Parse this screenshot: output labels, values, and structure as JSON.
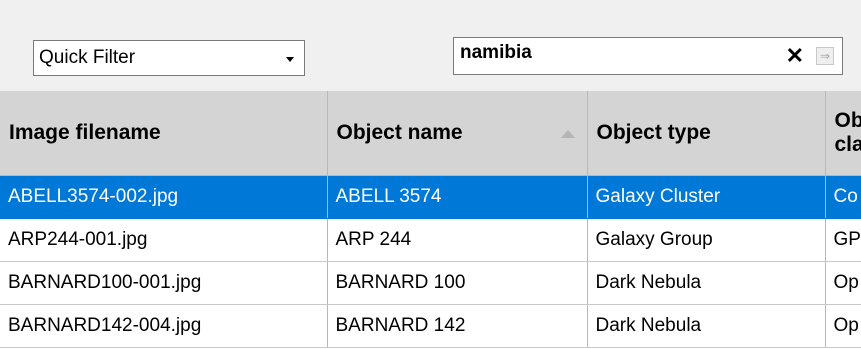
{
  "toolbar": {
    "quick_filter": {
      "selected": "Quick Filter"
    },
    "search": {
      "value": "namibia",
      "clear_glyph": "✕",
      "go_glyph": "⇒"
    }
  },
  "table": {
    "columns": [
      "Image filename",
      "Object name",
      "Object type",
      "Object class"
    ],
    "sort": {
      "column": "Object name",
      "direction": "ascending"
    },
    "rows": [
      {
        "selected": true,
        "cells": [
          "ABELL3574-002.jpg",
          "ABELL 3574",
          "Galaxy Cluster",
          "Co"
        ]
      },
      {
        "selected": false,
        "cells": [
          "ARP244-001.jpg",
          "ARP 244",
          "Galaxy Group",
          "GP"
        ]
      },
      {
        "selected": false,
        "cells": [
          "BARNARD100-001.jpg",
          "BARNARD 100",
          "Dark Nebula",
          "Op"
        ]
      },
      {
        "selected": false,
        "cells": [
          "BARNARD142-004.jpg",
          "BARNARD 142",
          "Dark Nebula",
          "Op"
        ]
      }
    ]
  },
  "colors": {
    "selection": "#0078d7",
    "header_bg": "#d4d4d4",
    "window_bg": "#f0f0f0"
  }
}
